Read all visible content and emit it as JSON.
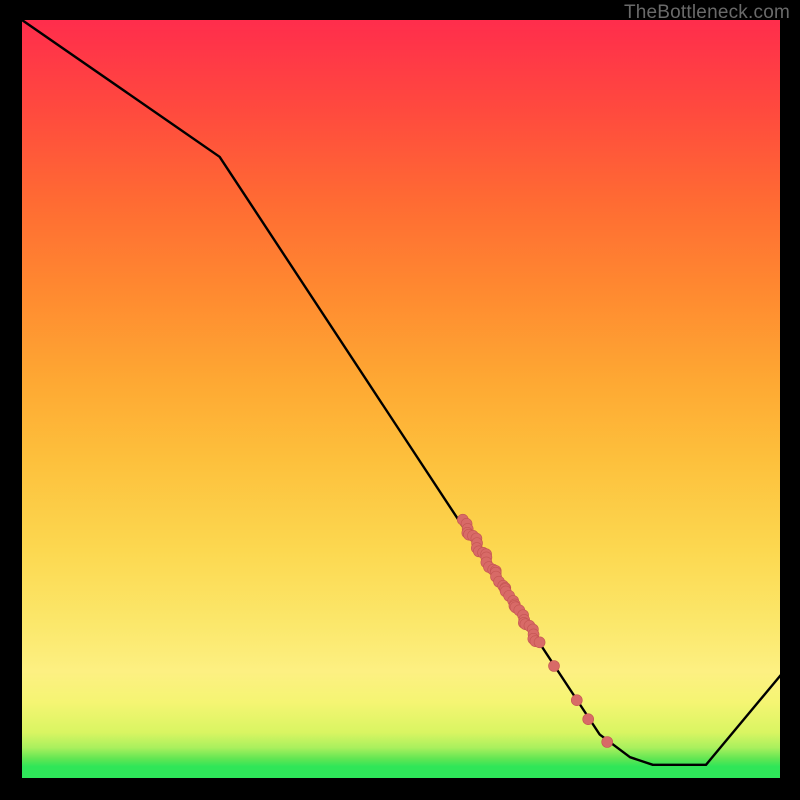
{
  "watermark": "TheBottleneck.com",
  "colors": {
    "line": "#000000",
    "marker": "#d86a67",
    "marker_stroke": "#c45552"
  },
  "chart_data": {
    "type": "line",
    "title": "",
    "xlabel": "",
    "ylabel": "",
    "xlim": [
      0,
      100
    ],
    "ylim": [
      0,
      100
    ],
    "line_points": [
      {
        "x": 0,
        "y": 100
      },
      {
        "x": 26,
        "y": 82
      },
      {
        "x": 76,
        "y": 6
      },
      {
        "x": 80,
        "y": 3
      },
      {
        "x": 83,
        "y": 2
      },
      {
        "x": 90,
        "y": 2
      },
      {
        "x": 100,
        "y": 14
      }
    ],
    "markers_clusterA": {
      "x_start": 58,
      "y_start": 34,
      "x_end": 68,
      "y_end": 18,
      "count": 40
    },
    "markers_isolated": [
      {
        "x": 70,
        "y": 15
      },
      {
        "x": 73,
        "y": 10.5
      },
      {
        "x": 74.5,
        "y": 8
      },
      {
        "x": 77,
        "y": 5
      }
    ]
  }
}
